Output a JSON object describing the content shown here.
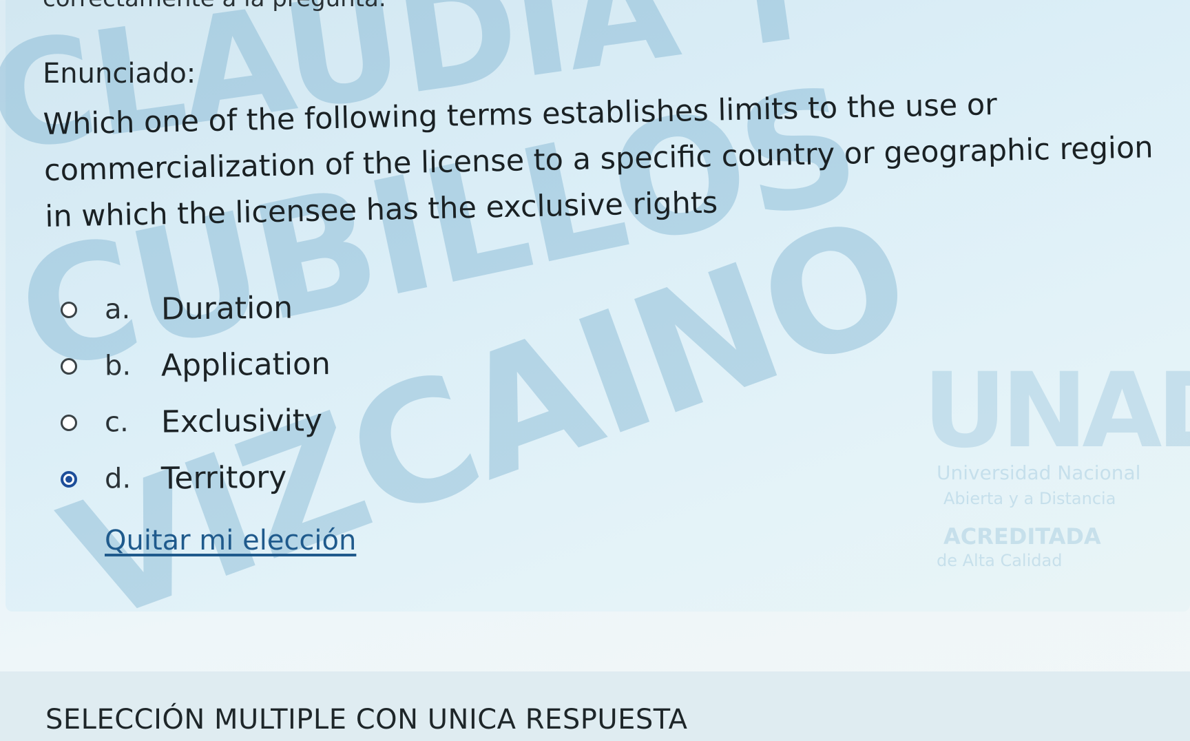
{
  "top_cut_text": "correctamente a la pregunta.",
  "watermark": {
    "line1": "CLAUDIA T",
    "line2": "CUBILLOS",
    "line3": "VIZCAINO"
  },
  "logo": {
    "acronym": "UNAD",
    "line1": "Universidad Nacional",
    "line2": "Abierta y a Distancia",
    "line3": "ACREDITADA",
    "line4": "de Alta Calidad"
  },
  "question": {
    "label": "Enunciado:",
    "text": "Which one of the following terms establishes limits to the use or commercialization of the license to a specific country or geographic region in which the licensee has the exclusive rights",
    "options": [
      {
        "letter": "a.",
        "text": "Duration",
        "selected": false
      },
      {
        "letter": "b.",
        "text": "Application",
        "selected": false
      },
      {
        "letter": "c.",
        "text": "Exclusivity",
        "selected": false
      },
      {
        "letter": "d.",
        "text": "Territory",
        "selected": true
      }
    ],
    "clear_choice_label": "Quitar mi elección"
  },
  "next_section_title": "SELECCIÓN MULTIPLE CON UNICA RESPUESTA"
}
